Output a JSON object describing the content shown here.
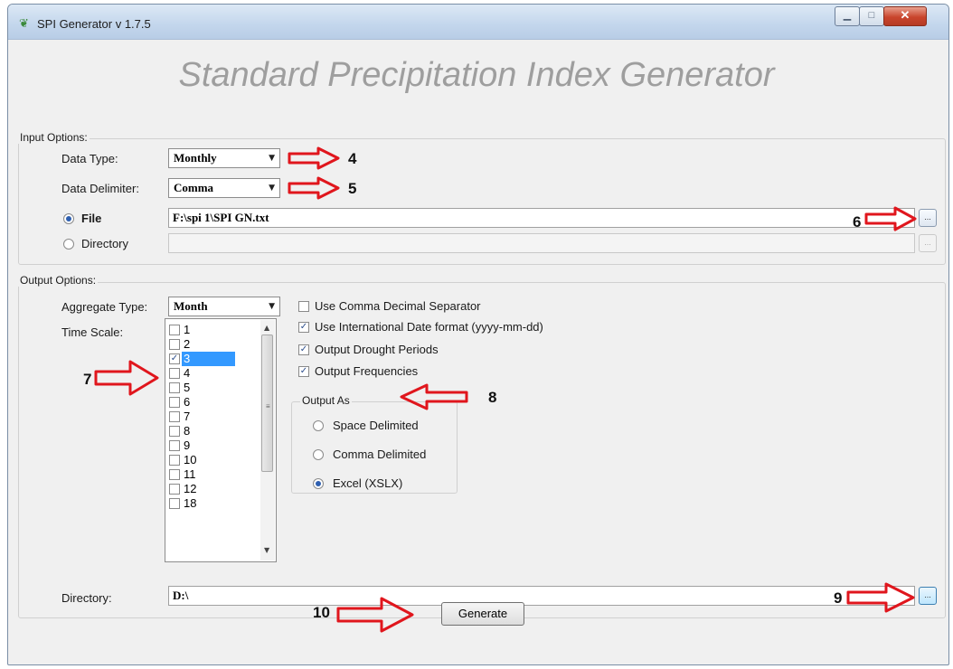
{
  "window": {
    "title": "SPI Generator  v 1.7.5",
    "icon": "app-icon",
    "controls": [
      "minimize-icon",
      "maximize-icon",
      "close-icon"
    ]
  },
  "header": {
    "title": "Standard Precipitation Index Generator"
  },
  "input_options": {
    "group_label": "Input Options:",
    "data_type": {
      "label": "Data Type:",
      "value": "Monthly"
    },
    "data_delimiter": {
      "label": "Data Delimiter:",
      "value": "Comma"
    },
    "file": {
      "label": "File",
      "selected": true,
      "value": "F:\\spi 1\\SPI GN.txt",
      "browse_label": "..."
    },
    "directory": {
      "label": "Directory",
      "selected": false,
      "value": "",
      "browse_label": "..."
    }
  },
  "output_options": {
    "group_label": "Output Options:",
    "aggregate_type": {
      "label": "Aggregate Type:",
      "value": "Month"
    },
    "time_scale": {
      "label": "Time Scale:",
      "items": [
        {
          "label": "1",
          "checked": false
        },
        {
          "label": "2",
          "checked": false
        },
        {
          "label": "3",
          "checked": true
        },
        {
          "label": "4",
          "checked": false
        },
        {
          "label": "5",
          "checked": false
        },
        {
          "label": "6",
          "checked": false
        },
        {
          "label": "7",
          "checked": false
        },
        {
          "label": "8",
          "checked": false
        },
        {
          "label": "9",
          "checked": false
        },
        {
          "label": "10",
          "checked": false
        },
        {
          "label": "11",
          "checked": false
        },
        {
          "label": "12",
          "checked": false
        },
        {
          "label": "18",
          "checked": false
        }
      ]
    },
    "checkboxes": [
      {
        "label": "Use Comma Decimal Separator",
        "checked": false
      },
      {
        "label": "Use International Date format (yyyy-mm-dd)",
        "checked": true
      },
      {
        "label": "Output Drought Periods",
        "checked": true
      },
      {
        "label": "Output Frequencies",
        "checked": true
      }
    ],
    "output_as": {
      "label": "Output As",
      "options": [
        {
          "label": "Space Delimited",
          "selected": false
        },
        {
          "label": "Comma Delimited",
          "selected": false
        },
        {
          "label": "Excel (XSLX)",
          "selected": true
        }
      ]
    },
    "directory": {
      "label": "Directory:",
      "value": "D:\\",
      "browse_label": "..."
    }
  },
  "generate_button": {
    "label": "Generate"
  },
  "annotations": [
    "4",
    "5",
    "6",
    "7",
    "8",
    "9",
    "10"
  ],
  "colors": {
    "annotation_arrow": "#e0161d",
    "title_gray": "#9e9e9e",
    "selection": "#3399ff"
  }
}
